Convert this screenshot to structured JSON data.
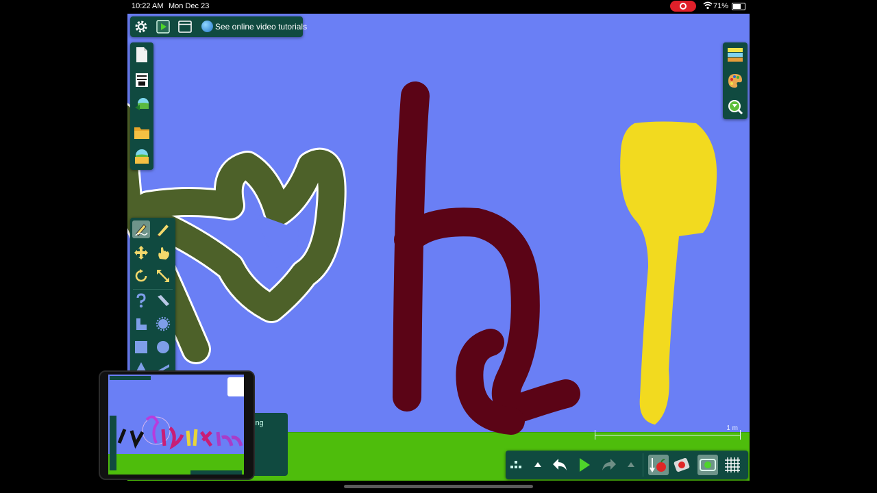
{
  "status_bar": {
    "time": "10:22 AM",
    "date": "Mon Dec 23",
    "battery": "71%",
    "battery_level": 0.71
  },
  "toolbar": {
    "tutorials_label": "See online video tutorials"
  },
  "scale": {
    "label": "1 m"
  },
  "background": {
    "sky": "#6a7ff5",
    "ground": "#4ebd0c"
  },
  "shapes": [
    {
      "name": "olive-scribble",
      "color": "#4d6129",
      "outline": "#ffffff"
    },
    {
      "name": "maroon-h-shape",
      "color": "#5b0416"
    },
    {
      "name": "yellow-spoon-shape",
      "color": "#f2da1f"
    }
  ],
  "behind_panel": {
    "label": "ing"
  },
  "icons": {
    "top": [
      "gear-icon",
      "play-icon",
      "window-icon",
      "globe-icon"
    ],
    "left": [
      "new-page-icon",
      "clipboard-icon",
      "import-icon",
      "folder-icon",
      "save-icon"
    ],
    "tools": [
      "draw-icon",
      "pencil-icon",
      "move-icon",
      "hand-icon",
      "rotate-icon",
      "scale-icon",
      "spring-icon",
      "knife-icon",
      "hinge-icon",
      "gear-tool-icon",
      "box-icon",
      "circle-icon"
    ],
    "right": [
      "layers-icon",
      "palette-icon",
      "zoom-icon"
    ],
    "bottom": [
      "grid-menu-icon",
      "up-arrow-icon",
      "undo-icon",
      "play-icon",
      "redo-icon",
      "up-arrow-icon",
      "fixate-icon",
      "collision-icon",
      "follow-camera-icon",
      "grid-icon"
    ]
  }
}
